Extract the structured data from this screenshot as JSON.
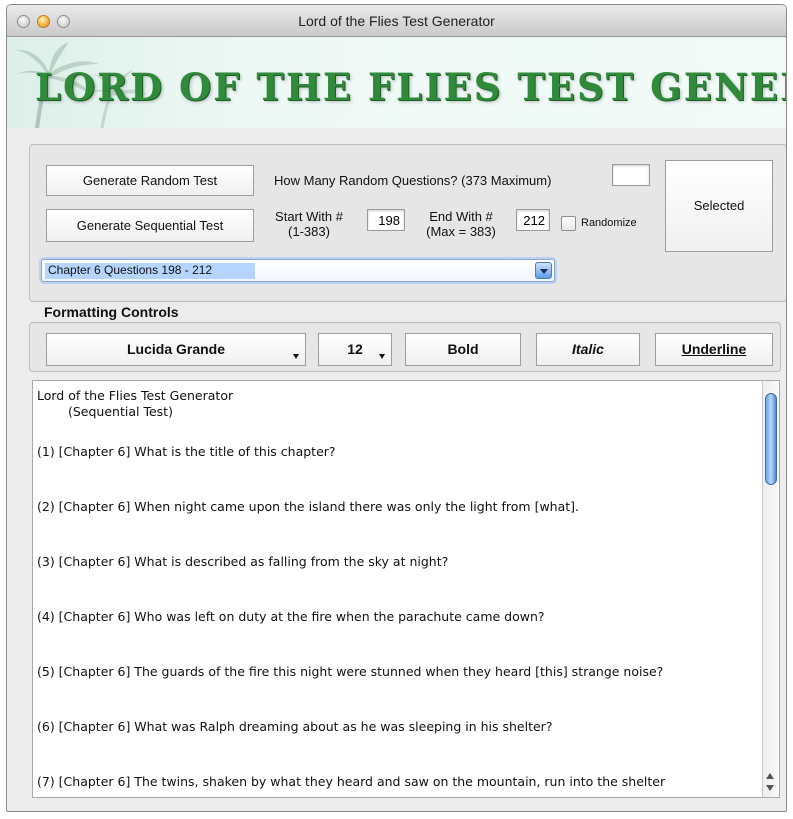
{
  "window": {
    "title": "Lord of the Flies Test Generator"
  },
  "banner": {
    "title": "LORD OF THE FLIES TEST GENERATOR"
  },
  "controls": {
    "random_button": "Generate Random Test",
    "how_many_label": "How Many Random Questions? (373 Maximum)",
    "how_many_value": "",
    "selected_button": "Selected",
    "sequential_button": "Generate Sequential Test",
    "start_label_1": "Start With #",
    "start_label_2": "(1-383)",
    "start_value": "198",
    "end_label_1": "End With #",
    "end_label_2": "(Max = 383)",
    "end_value": "212",
    "randomize_label": "Randomize",
    "randomize_checked": false,
    "chapter_select": "Chapter 6  Questions 198 - 212"
  },
  "formatting": {
    "title": "Formatting Controls",
    "font": "Lucida Grande",
    "size": "12",
    "bold": "Bold",
    "italic": "Italic",
    "underline": "Underline"
  },
  "output": {
    "heading": "Lord of the Flies Test Generator",
    "subheading": "(Sequential Test)",
    "questions": [
      "(1)  [Chapter 6]  What is the title of this chapter?",
      "(2)  [Chapter 6]  When night came upon the island there was only the light from [what].",
      "(3)  [Chapter 6]  What is described as falling from the sky at night?",
      "(4)  [Chapter 6]  Who was left on duty at the fire when the parachute came down?",
      "(5)  [Chapter 6]  The guards of the fire this night were stunned when they heard [this] strange noise?",
      "(6)  [Chapter 6]  What was Ralph dreaming about as he was sleeping in his shelter?",
      "(7)  [Chapter 6]  The twins, shaken by what they heard and saw on the mountain, run into the shelter"
    ]
  },
  "icons": {
    "close": "close-icon",
    "minimize": "minimize-icon",
    "zoom": "zoom-icon",
    "palm": "palm-tree-icon",
    "dropdown": "chevron-down-icon"
  },
  "colors": {
    "banner_text": "#2f8a3a",
    "selection": "#b5d5ff",
    "accent_blue": "#5c9ce5"
  }
}
